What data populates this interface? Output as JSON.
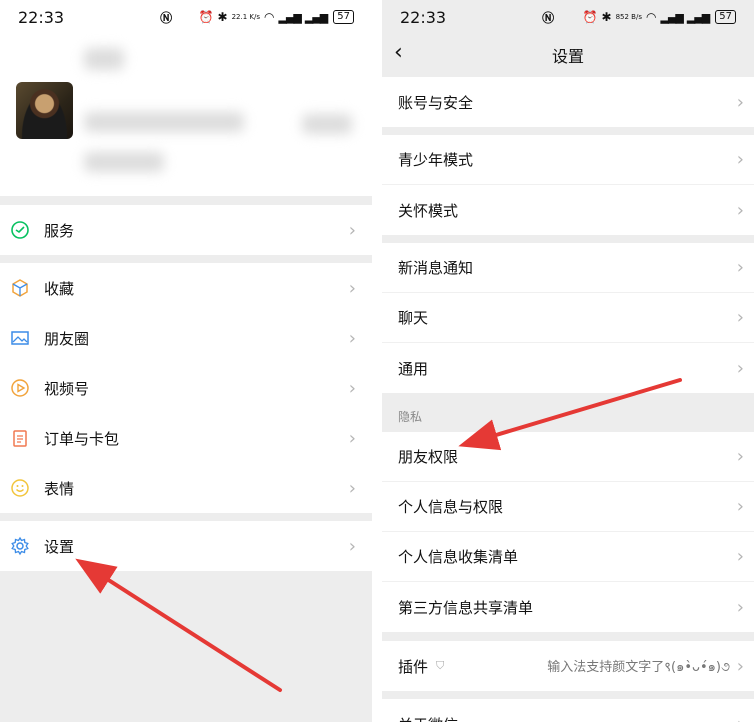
{
  "status_bar": {
    "time": "22:33",
    "left_speed": "22.1 K/s",
    "right_speed": "852 B/s",
    "battery": "57"
  },
  "left": {
    "menu": [
      {
        "id": "services",
        "label": "服务",
        "icon": "services-icon",
        "color": "#07c160"
      },
      {
        "id": "favorites",
        "label": "收藏",
        "icon": "cube-icon",
        "color": "#f2a43c"
      },
      {
        "id": "moments",
        "label": "朋友圈",
        "icon": "image-icon",
        "color": "#3c8ce7"
      },
      {
        "id": "channels",
        "label": "视频号",
        "icon": "play-icon",
        "color": "#f2a43c"
      },
      {
        "id": "orders",
        "label": "订单与卡包",
        "icon": "clipboard-icon",
        "color": "#f07850"
      },
      {
        "id": "stickers",
        "label": "表情",
        "icon": "smile-icon",
        "color": "#f2c53c"
      },
      {
        "id": "settings",
        "label": "设置",
        "icon": "gear-icon",
        "color": "#3c8ce7"
      }
    ]
  },
  "right": {
    "title": "设置",
    "groups": [
      [
        "账号与安全"
      ],
      [
        "青少年模式",
        "关怀模式"
      ],
      [
        "新消息通知",
        "聊天",
        "通用"
      ],
      [
        "朋友权限",
        "个人信息与权限",
        "个人信息收集清单",
        "第三方信息共享清单"
      ],
      [
        "插件"
      ],
      [
        "关于微信"
      ]
    ],
    "privacy_label": "隐私",
    "plugin_extra": "输入法支持颜文字了९(๑•̀ᴗ•́๑)૭"
  },
  "colors": {
    "arrow": "#e53935",
    "chevron": "#b5b5b5",
    "background": "#ededed"
  }
}
